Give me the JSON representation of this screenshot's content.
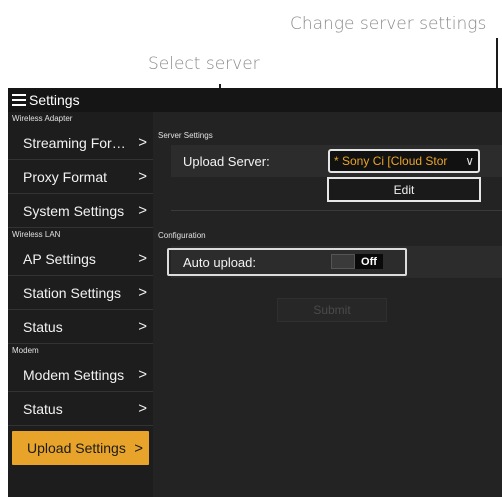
{
  "callouts": {
    "change_server_settings": "Change server settings",
    "select_server": "Select server"
  },
  "titlebar": {
    "title": "Settings",
    "icon": "hamburger-menu-icon"
  },
  "sidebar": {
    "sections": [
      {
        "label": "Wireless Adapter",
        "items": [
          "Streaming For…",
          "Proxy Format",
          "System Settings"
        ]
      },
      {
        "label": "Wireless LAN",
        "items": [
          "AP Settings",
          "Station Settings",
          "Status"
        ]
      },
      {
        "label": "Modem",
        "items": [
          "Modem Settings",
          "Status"
        ]
      }
    ],
    "active_item": "Upload Settings",
    "chevron": ">"
  },
  "main": {
    "server_settings": {
      "group_label": "Server Settings",
      "upload_server_label": "Upload Server:",
      "upload_server_value": "* Sony Ci [Cloud Stor",
      "edit_label": "Edit"
    },
    "configuration": {
      "group_label": "Configuration",
      "auto_upload_label": "Auto upload:",
      "auto_upload_state": "Off"
    },
    "submit_label": "Submit"
  },
  "colors": {
    "accent": "#e8a42a",
    "background": "#222222",
    "callout_text": "#8a8a8a"
  }
}
